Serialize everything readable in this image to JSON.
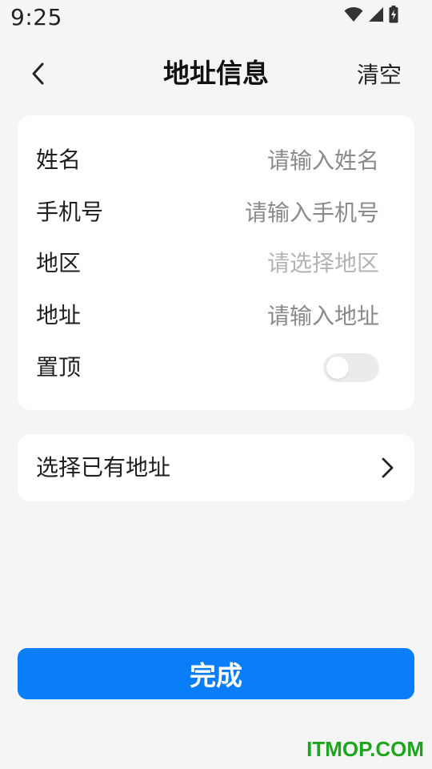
{
  "status_bar": {
    "time": "9:25",
    "icons": [
      "wifi-icon",
      "cellular-signal-icon",
      "battery-charging-icon"
    ]
  },
  "header": {
    "title": "地址信息",
    "clear_label": "清空",
    "back_icon": "chevron-left-icon"
  },
  "form": {
    "name": {
      "label": "姓名",
      "placeholder": "请输入姓名",
      "value": ""
    },
    "phone": {
      "label": "手机号",
      "placeholder": "请输入手机号",
      "value": ""
    },
    "region": {
      "label": "地区",
      "placeholder": "请选择地区"
    },
    "address": {
      "label": "地址",
      "placeholder": "请输入地址",
      "value": ""
    },
    "pin_top": {
      "label": "置顶",
      "enabled": false
    }
  },
  "existing_address": {
    "label": "选择已有地址",
    "icon": "chevron-right-icon"
  },
  "actions": {
    "done_label": "完成"
  },
  "watermark": "ITMOP.COM",
  "colors": {
    "background": "#f5f5f5",
    "card": "#ffffff",
    "primary": "#0a7ef8",
    "placeholder": "#8a8a8a",
    "disabled_placeholder": "#b3b3b3",
    "toggle_off": "#ebebeb",
    "watermark": "#1ea51e"
  }
}
